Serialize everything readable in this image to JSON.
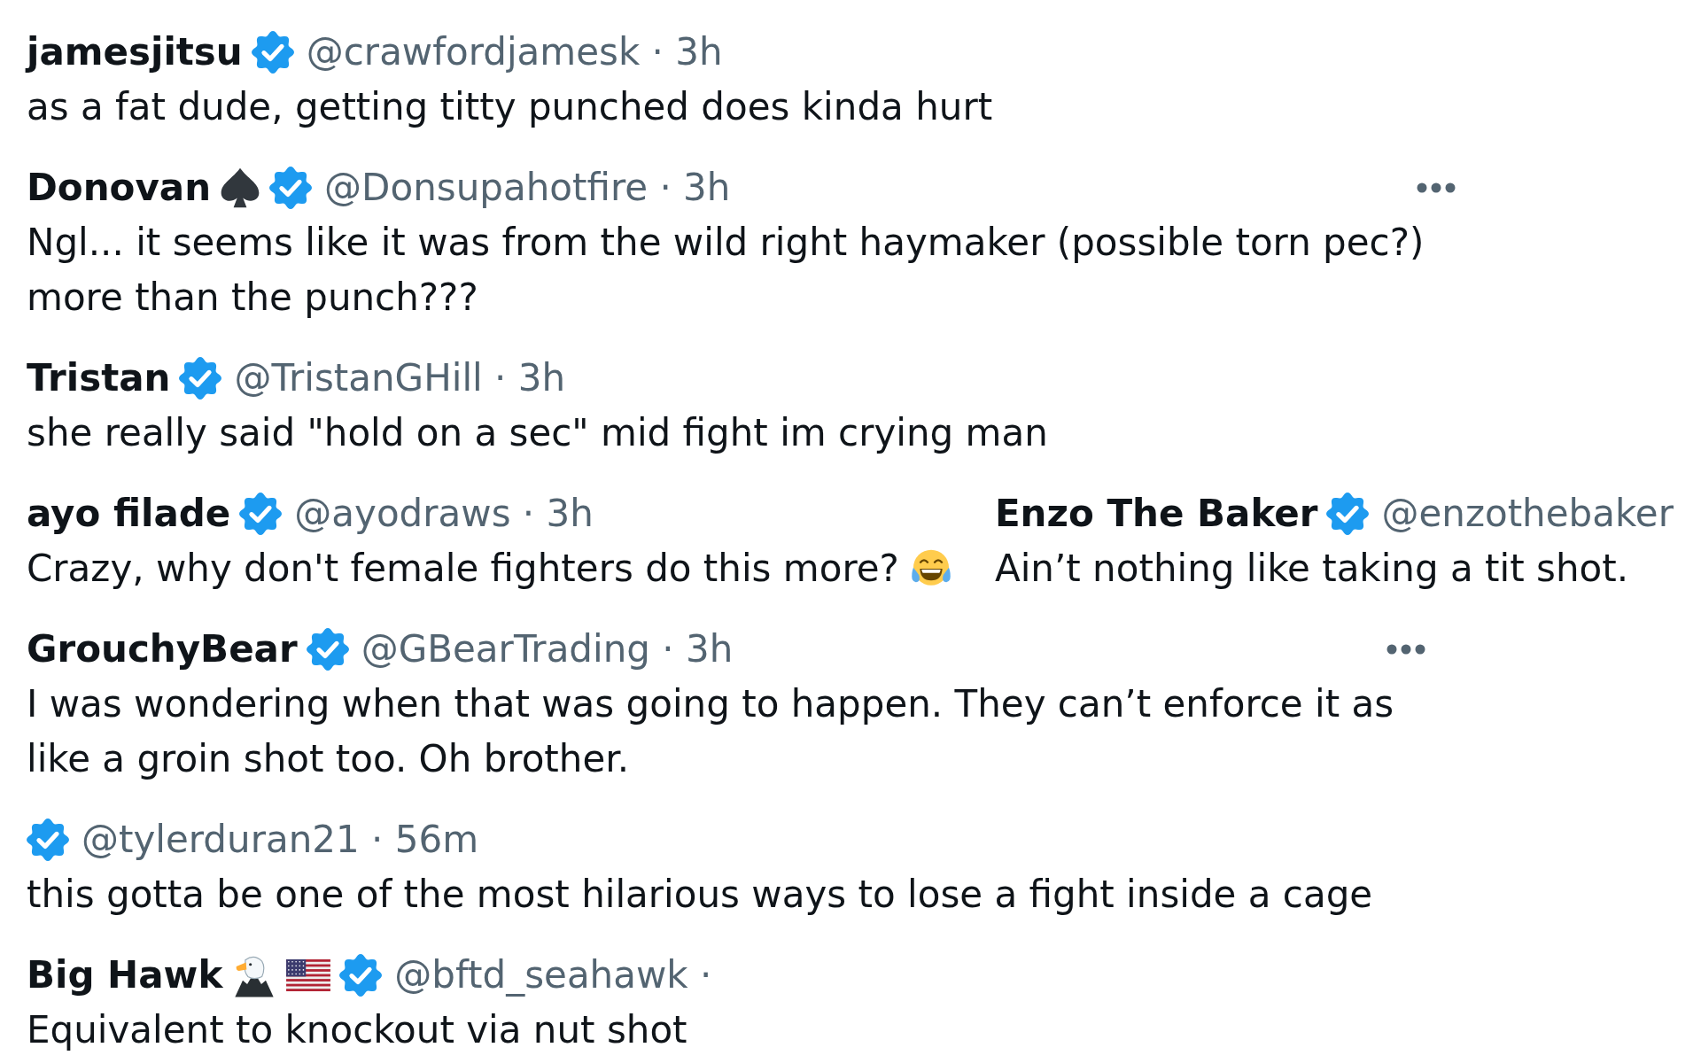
{
  "rows": [
    {
      "tweets": [
        {
          "name": "jamesjitsu",
          "verified": true,
          "meta": "@crawfordjamesk · 3h",
          "more_button": false,
          "text": "as a fat dude, getting titty punched does kinda hurt"
        }
      ]
    },
    {
      "tweets": [
        {
          "name": "Donovan",
          "name_icons": [
            {
              "kind": "spade"
            }
          ],
          "verified": true,
          "meta": "@Donsupahotfire · 3h",
          "more_button": true,
          "text": "Ngl... it seems like it was from the wild right haymaker (possible torn pec?)\nmore than the punch???"
        }
      ]
    },
    {
      "tweets": [
        {
          "name": "Tristan",
          "verified": true,
          "meta": "@TristanGHill · 3h",
          "more_button": false,
          "text": "she really said \"hold on a sec\" mid fight im crying man"
        }
      ]
    },
    {
      "tweets": [
        {
          "name": "ayo filade",
          "verified": true,
          "meta": "@ayodraws · 3h",
          "more_button": false,
          "text": "Crazy, why don't female fighters do this more?",
          "text_icons": [
            {
              "kind": "laughing"
            }
          ]
        },
        {
          "name": "Enzo The Baker",
          "verified": true,
          "meta": "@enzothebaker",
          "more_button": false,
          "text": "Ain’t nothing like taking a tit shot."
        }
      ]
    },
    {
      "tweets": [
        {
          "name": "GrouchyBear",
          "verified": true,
          "meta": "@GBearTrading · 3h",
          "more_button": true,
          "text": "I was wondering when that was going to happen. They can’t enforce it as\nlike a groin shot too. Oh brother."
        }
      ]
    },
    {
      "tweets": [
        {
          "verified": true,
          "meta": "@tylerduran21 · 56m",
          "more_button": false,
          "text": "this gotta be one of the most hilarious ways to lose a fight inside a cage"
        }
      ]
    },
    {
      "tweets": [
        {
          "name": "Big Hawk",
          "name_icons": [
            {
              "kind": "eagle"
            },
            {
              "kind": "flag"
            }
          ],
          "verified": true,
          "meta": "@bftd_seahawk ·",
          "more_button": false,
          "text": "Equivalent to knockout via nut shot"
        }
      ]
    }
  ]
}
